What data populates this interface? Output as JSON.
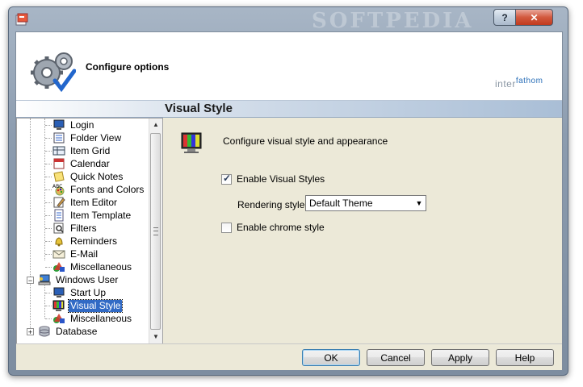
{
  "window": {
    "watermark": "SOFTPEDIA",
    "help_label": "?",
    "close_label": "✕"
  },
  "header": {
    "title": "Configure options",
    "logo_part1": "inter",
    "logo_part2": "fathom"
  },
  "section": {
    "title": "Visual Style"
  },
  "tree": {
    "items": [
      {
        "label": "Login",
        "icon": "login-icon"
      },
      {
        "label": "Folder View",
        "icon": "folder-view-icon"
      },
      {
        "label": "Item Grid",
        "icon": "grid-icon"
      },
      {
        "label": "Calendar",
        "icon": "calendar-icon"
      },
      {
        "label": "Quick Notes",
        "icon": "notes-icon"
      },
      {
        "label": "Fonts and Colors",
        "icon": "fonts-icon"
      },
      {
        "label": "Item Editor",
        "icon": "editor-icon"
      },
      {
        "label": "Item Template",
        "icon": "template-icon"
      },
      {
        "label": "Filters",
        "icon": "filter-icon"
      },
      {
        "label": "Reminders",
        "icon": "bell-icon"
      },
      {
        "label": "E-Mail",
        "icon": "envelope-icon"
      },
      {
        "label": "Miscellaneous",
        "icon": "shapes-icon"
      },
      {
        "label": "Windows User",
        "icon": "user-icon"
      },
      {
        "label": "Start Up",
        "icon": "monitor-icon"
      },
      {
        "label": "Visual Style",
        "icon": "visual-style-icon"
      },
      {
        "label": "Miscellaneous",
        "icon": "shapes-icon"
      },
      {
        "label": "Database",
        "icon": "database-icon"
      }
    ],
    "collapse_symbol": "−",
    "expand_symbol": "+"
  },
  "panel": {
    "description": "Configure visual style and appearance",
    "enable_visual_styles": {
      "label": "Enable Visual Styles",
      "checked": true
    },
    "rendering_style": {
      "label": "Rendering style:",
      "value": "Default Theme"
    },
    "enable_chrome": {
      "label": "Enable chrome style",
      "checked": false
    }
  },
  "buttons": {
    "ok": "OK",
    "cancel": "Cancel",
    "apply": "Apply",
    "help": "Help"
  }
}
